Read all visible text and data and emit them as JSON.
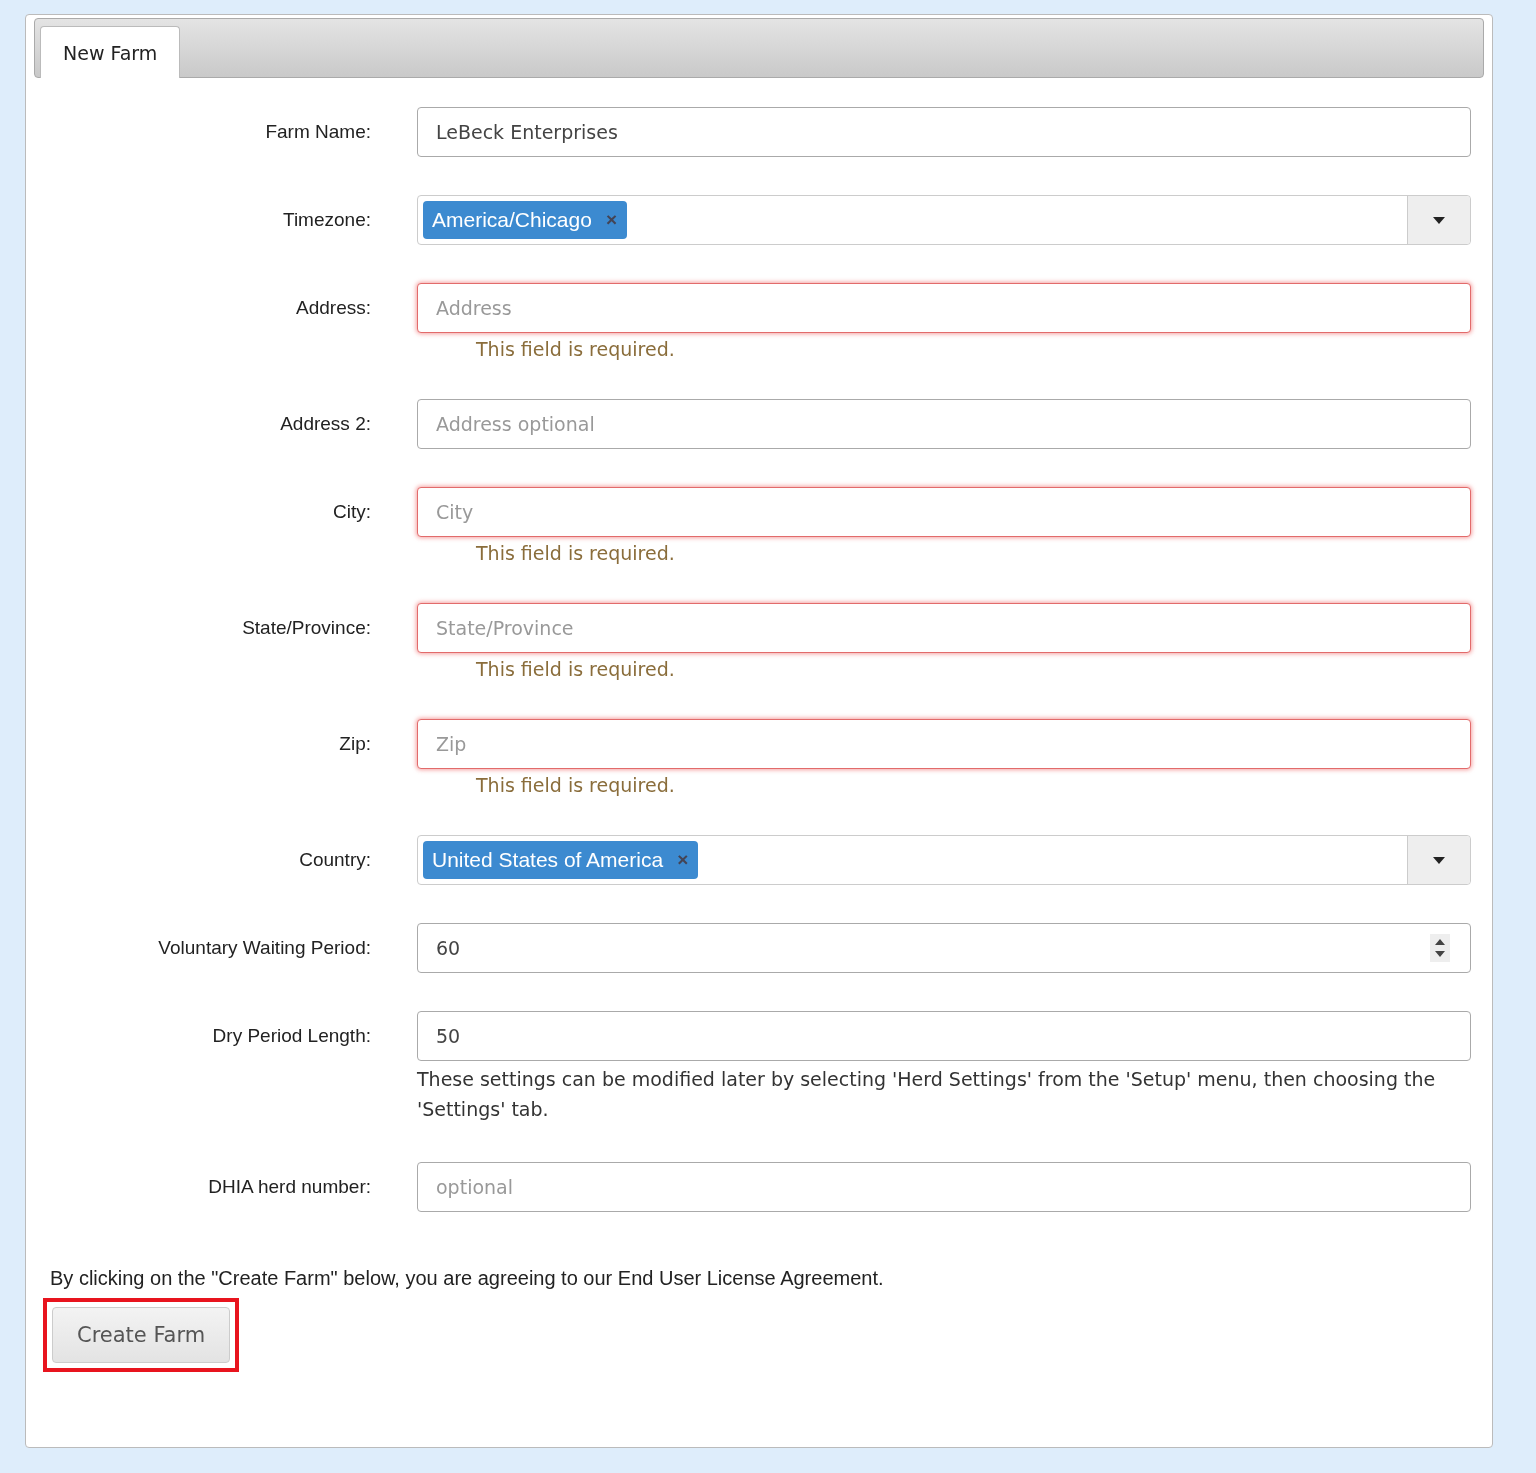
{
  "tabs": [
    {
      "label": "New Farm",
      "selected": true
    }
  ],
  "fields": [
    {
      "kind": "text",
      "label": "Farm Name:",
      "value": "LeBeck Enterprises",
      "invalid": false
    },
    {
      "kind": "select",
      "label": "Timezone:",
      "value": "America/Chicago",
      "remove": "×",
      "invalid": false
    },
    {
      "kind": "text",
      "label": "Address:",
      "placeholder": "Address",
      "invalid": true,
      "error": "This field is required."
    },
    {
      "kind": "text",
      "label": "Address 2:",
      "placeholder": "Address optional",
      "invalid": false
    },
    {
      "kind": "text",
      "label": "City:",
      "placeholder": "City",
      "invalid": true,
      "error": "This field is required."
    },
    {
      "kind": "text",
      "label": "State/Province:",
      "placeholder": "State/Province",
      "invalid": true,
      "error": "This field is required."
    },
    {
      "kind": "text",
      "label": "Zip:",
      "placeholder": "Zip",
      "invalid": true,
      "error": "This field is required."
    },
    {
      "kind": "select",
      "label": "Country:",
      "value": "United States of America",
      "remove": "×",
      "invalid": false
    },
    {
      "kind": "number",
      "label": "Voluntary Waiting Period:",
      "value": "60",
      "invalid": false
    },
    {
      "kind": "text",
      "label": "Dry Period Length:",
      "value": "50",
      "invalid": false,
      "help": "These settings can be modified later by selecting 'Herd Settings' from the 'Setup' menu, then choosing the 'Settings' tab."
    },
    {
      "kind": "text",
      "label": "DHIA herd number:",
      "placeholder": "optional",
      "invalid": false
    }
  ],
  "agreement": "By clicking on the \"Create Farm\" below, you are agreeing to our End User License Agreement.",
  "submit": {
    "label": "Create Farm",
    "highlighted": true
  }
}
